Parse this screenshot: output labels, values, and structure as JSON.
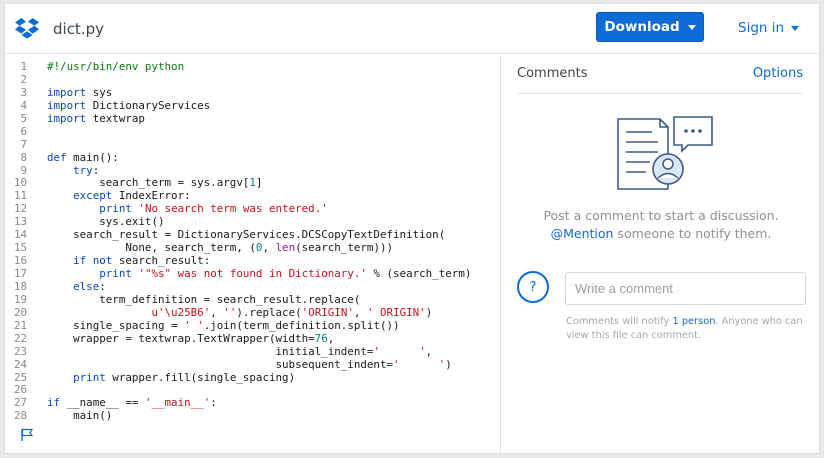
{
  "header": {
    "logo_icon": "dropbox-logo-icon",
    "filename": "dict.py",
    "download_label": "Download",
    "signin_label": "Sign in",
    "accent_color": "#0d6bd7"
  },
  "code": {
    "language": "python",
    "lines": [
      {
        "n": "1",
        "t": "#!/usr/bin/env python"
      },
      {
        "n": "2",
        "t": ""
      },
      {
        "n": "3",
        "t": "import sys"
      },
      {
        "n": "4",
        "t": "import DictionaryServices"
      },
      {
        "n": "5",
        "t": "import textwrap"
      },
      {
        "n": "6",
        "t": ""
      },
      {
        "n": "7",
        "t": ""
      },
      {
        "n": "8",
        "t": "def main():"
      },
      {
        "n": "9",
        "t": "    try:"
      },
      {
        "n": "10",
        "t": "        search_term = sys.argv[1]"
      },
      {
        "n": "11",
        "t": "    except IndexError:"
      },
      {
        "n": "12",
        "t": "        print 'No search term was entered.'"
      },
      {
        "n": "13",
        "t": "        sys.exit()"
      },
      {
        "n": "14",
        "t": "    search_result = DictionaryServices.DCSCopyTextDefinition("
      },
      {
        "n": "15",
        "t": "            None, search_term, (0, len(search_term)))"
      },
      {
        "n": "16",
        "t": "    if not search_result:"
      },
      {
        "n": "17",
        "t": "        print '\"%s\" was not found in Dictionary.' % (search_term)"
      },
      {
        "n": "18",
        "t": "    else:"
      },
      {
        "n": "19",
        "t": "        term_definition = search_result.replace("
      },
      {
        "n": "20",
        "t": "                u'\\u25B6', '').replace('ORIGIN', ' ORIGIN')"
      },
      {
        "n": "21",
        "t": "    single_spacing = ' '.join(term_definition.split())"
      },
      {
        "n": "22",
        "t": "    wrapper = textwrap.TextWrapper(width=76,"
      },
      {
        "n": "23",
        "t": "                                   initial_indent='      ',"
      },
      {
        "n": "24",
        "t": "                                   subsequent_indent='      ')"
      },
      {
        "n": "25",
        "t": "    print wrapper.fill(single_spacing)"
      },
      {
        "n": "26",
        "t": ""
      },
      {
        "n": "27",
        "t": "if __name__ == '__main__':"
      },
      {
        "n": "28",
        "t": "    main()"
      }
    ],
    "flag_icon": "flag-icon"
  },
  "comments": {
    "title": "Comments",
    "options_label": "Options",
    "illustration_icon": "document-comment-illustration-icon",
    "empty_line1": "Post a comment to start a discussion.",
    "empty_mention": "@Mention",
    "empty_line2_rest": " someone to notify them.",
    "avatar_placeholder": "?",
    "input_placeholder": "Write a comment",
    "note_prefix": "Comments will notify ",
    "note_link": "1 person",
    "note_suffix": ". Anyone who can view this file can comment."
  }
}
